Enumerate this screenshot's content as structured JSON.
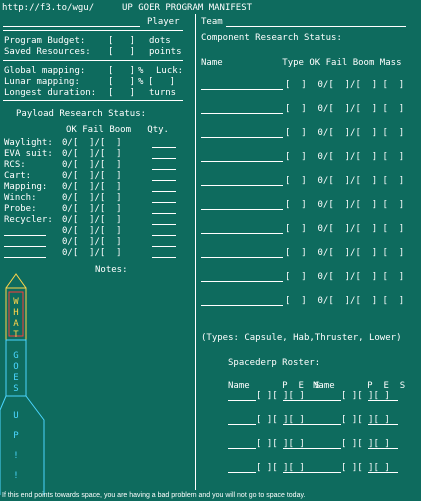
{
  "header": {
    "url": "http://f3.to/wgu/",
    "title": "UP GOER PROGRAM MANIFEST"
  },
  "left": {
    "player_label": "Player",
    "budget_label": "Program Budget:",
    "budget_unit": "dots",
    "saved_label": "Saved Resources:",
    "saved_unit": "points",
    "luck_label": "Luck:",
    "global_label": "Global mapping:",
    "global_unit": "%",
    "lunar_label": "Lunar mapping:",
    "lunar_unit": "%",
    "longest_label": "Longest duration:",
    "longest_unit": "turns",
    "bracket": "[   ]",
    "payload_title": "Payload Research Status:",
    "payload_cols": "OK Fail Boom   Qty.",
    "payload_rows": [
      "Waylight:",
      "EVA suit:",
      "RCS:",
      "Cart:",
      "Mapping:",
      "Winch:",
      "Probe:",
      "Recycler:",
      "",
      "",
      ""
    ],
    "payload_cells": "0/[  ]/[  ]",
    "notes_label": "Notes:"
  },
  "right": {
    "team_label": "Team",
    "component_title": "Component Research Status:",
    "component_cols": "Name           Type OK Fail Boom Mass",
    "component_cell": "[  ]  0/[  ]/[  ] [  ]",
    "component_rows": 10,
    "types_note": "(Types: Capsule, Hab,Thruster, Lower)",
    "roster_title": "Spacederp Roster:",
    "roster_cols_left": "Name      P  E  S",
    "roster_cols_right": "Name      P  E  S",
    "roster_cell": "[ ][ ][ ]",
    "roster_rows": 4
  },
  "rocket": {
    "letters_top": [
      "W",
      "H",
      "A",
      "T"
    ],
    "letters_mid": [
      "G",
      "O",
      "E",
      "S"
    ],
    "letters_low": [
      "U",
      "P",
      "!",
      "!"
    ],
    "colors": {
      "top": "#ffd54a",
      "band": "#ff3b3b",
      "body": "#4ad6ff"
    }
  },
  "footer": "If this end points towards space, you are having a bad problem and you will not go to space today."
}
